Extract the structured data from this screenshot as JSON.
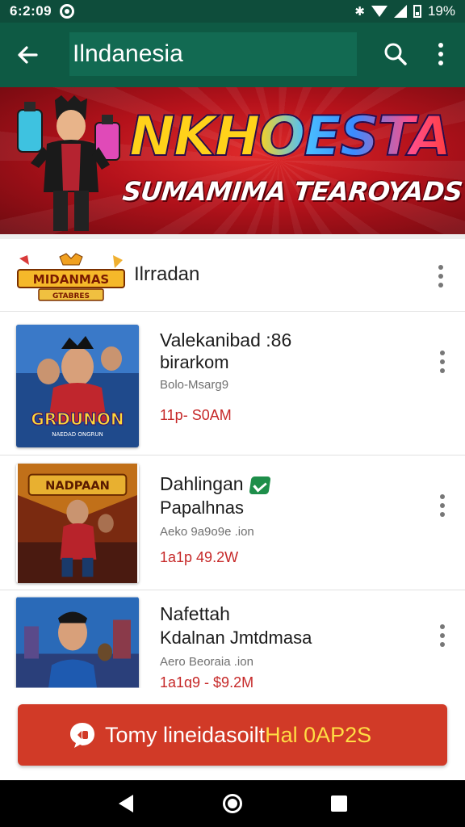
{
  "status_bar": {
    "time": "6:2:09",
    "battery": "19%"
  },
  "app_bar": {
    "title": "Ilndanesia"
  },
  "banner": {
    "headline": "NKHOESTA",
    "subline": "SUMAMIMA TEAROYADS"
  },
  "section": {
    "logo_text_top": "MIDANMAS",
    "logo_text_bottom": "GTABRES",
    "label": "Ilrradan"
  },
  "items": [
    {
      "name": "Valekanibad :86",
      "sub": "birarkom",
      "meta": "Bolo-Msarg9",
      "price": "11p- S0AM",
      "thumb_text": "GRDUNON",
      "thumb_sub": "NAEDAD ONGRUN",
      "verified": false
    },
    {
      "name": "Dahlingan",
      "sub": "Papalhnas",
      "meta": "Aeko 9a9o9e .ion",
      "price": "1a1p 49.2W",
      "thumb_text": "NADPAAN",
      "verified": true
    },
    {
      "name": "Nafettah",
      "sub": "Kdalnan Jmtdmasa",
      "meta": "Aero Beoraia .ion",
      "price": "1a1g9 - $9.2M",
      "verified": false
    }
  ],
  "cta": {
    "label_main": "Tomy lineidasoilt",
    "label_highlight": "Hal 0AP2S"
  },
  "colors": {
    "app_bar": "#0e5a44",
    "status_bar": "#0e4d3b",
    "cta": "#d13a27",
    "price": "#c62828",
    "verified": "#1e8e4a"
  }
}
